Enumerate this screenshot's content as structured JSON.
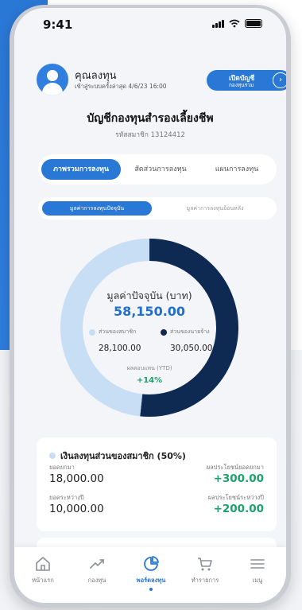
{
  "status_bar": {
    "time": "9:41"
  },
  "header": {
    "user_name": "คุณลงทุน",
    "last_login": "เข้าสู่ระบบครั้งล่าสุด 4/6/23 16:00",
    "open_account_line1": "เปิดบัญชี",
    "open_account_line2": "กองทุนรวม"
  },
  "page": {
    "title": "บัญชีกองทุนสำรองเลี้ยงชีพ",
    "member_id": "รหัสสมาชิก 13124412"
  },
  "tabs": [
    {
      "label": "ภาพรวมการลงทุน",
      "active": true
    },
    {
      "label": "สัดส่วนการลงทุน",
      "active": false
    },
    {
      "label": "แผนการลงทุน",
      "active": false
    }
  ],
  "subtabs": [
    {
      "label": "มูลค่าการลงทุนปัจจุบัน",
      "active": true
    },
    {
      "label": "มูลค่าการลงทุนย้อนหลัง",
      "active": false
    }
  ],
  "summary": {
    "current_value_label": "มูลค่าปัจจุบัน (บาท)",
    "current_value": "58,150.00",
    "member_label": "ส่วนของสมาชิก",
    "member_amount": "28,100.00",
    "employer_label": "ส่วนของนายจ้าง",
    "employer_amount": "30,050.00",
    "ytd_label": "ผลตอบแทน (YTD)",
    "ytd_value": "+14%"
  },
  "chart_data": {
    "type": "pie",
    "categories": [
      "ส่วนของสมาชิก",
      "ส่วนของนายจ้าง"
    ],
    "values": [
      28100.0,
      30050.0
    ],
    "colors": [
      "#c7def5",
      "#0f2a52"
    ]
  },
  "member_card": {
    "title": "เงินลงทุนส่วนของสมาชิก (50%)",
    "contribution_label": "ยอดยกมา",
    "contribution_value": "18,000.00",
    "contribution_gain_label": "ผลประโยชน์ยอดยกมา",
    "contribution_gain": "+300.00",
    "period_label": "ยอดระหว่างปี",
    "period_value": "10,000.00",
    "period_gain_label": "ผลประโยชน์ระหว่างปี",
    "period_gain": "+200.00"
  },
  "bottom_nav": [
    {
      "label": "หน้าแรก",
      "icon": "home-icon",
      "active": false
    },
    {
      "label": "กองทุน",
      "icon": "trend-icon",
      "active": false
    },
    {
      "label": "พอร์ตลงทุน",
      "icon": "pie-chart-icon",
      "active": true
    },
    {
      "label": "ทำรายการ",
      "icon": "cart-icon",
      "active": false
    },
    {
      "label": "เมนู",
      "icon": "menu-icon",
      "active": false
    }
  ],
  "colors": {
    "primary": "#2a78d6",
    "member_portion": "#c7def5",
    "employer_portion": "#0f2a52",
    "gain": "#1aa36a"
  }
}
